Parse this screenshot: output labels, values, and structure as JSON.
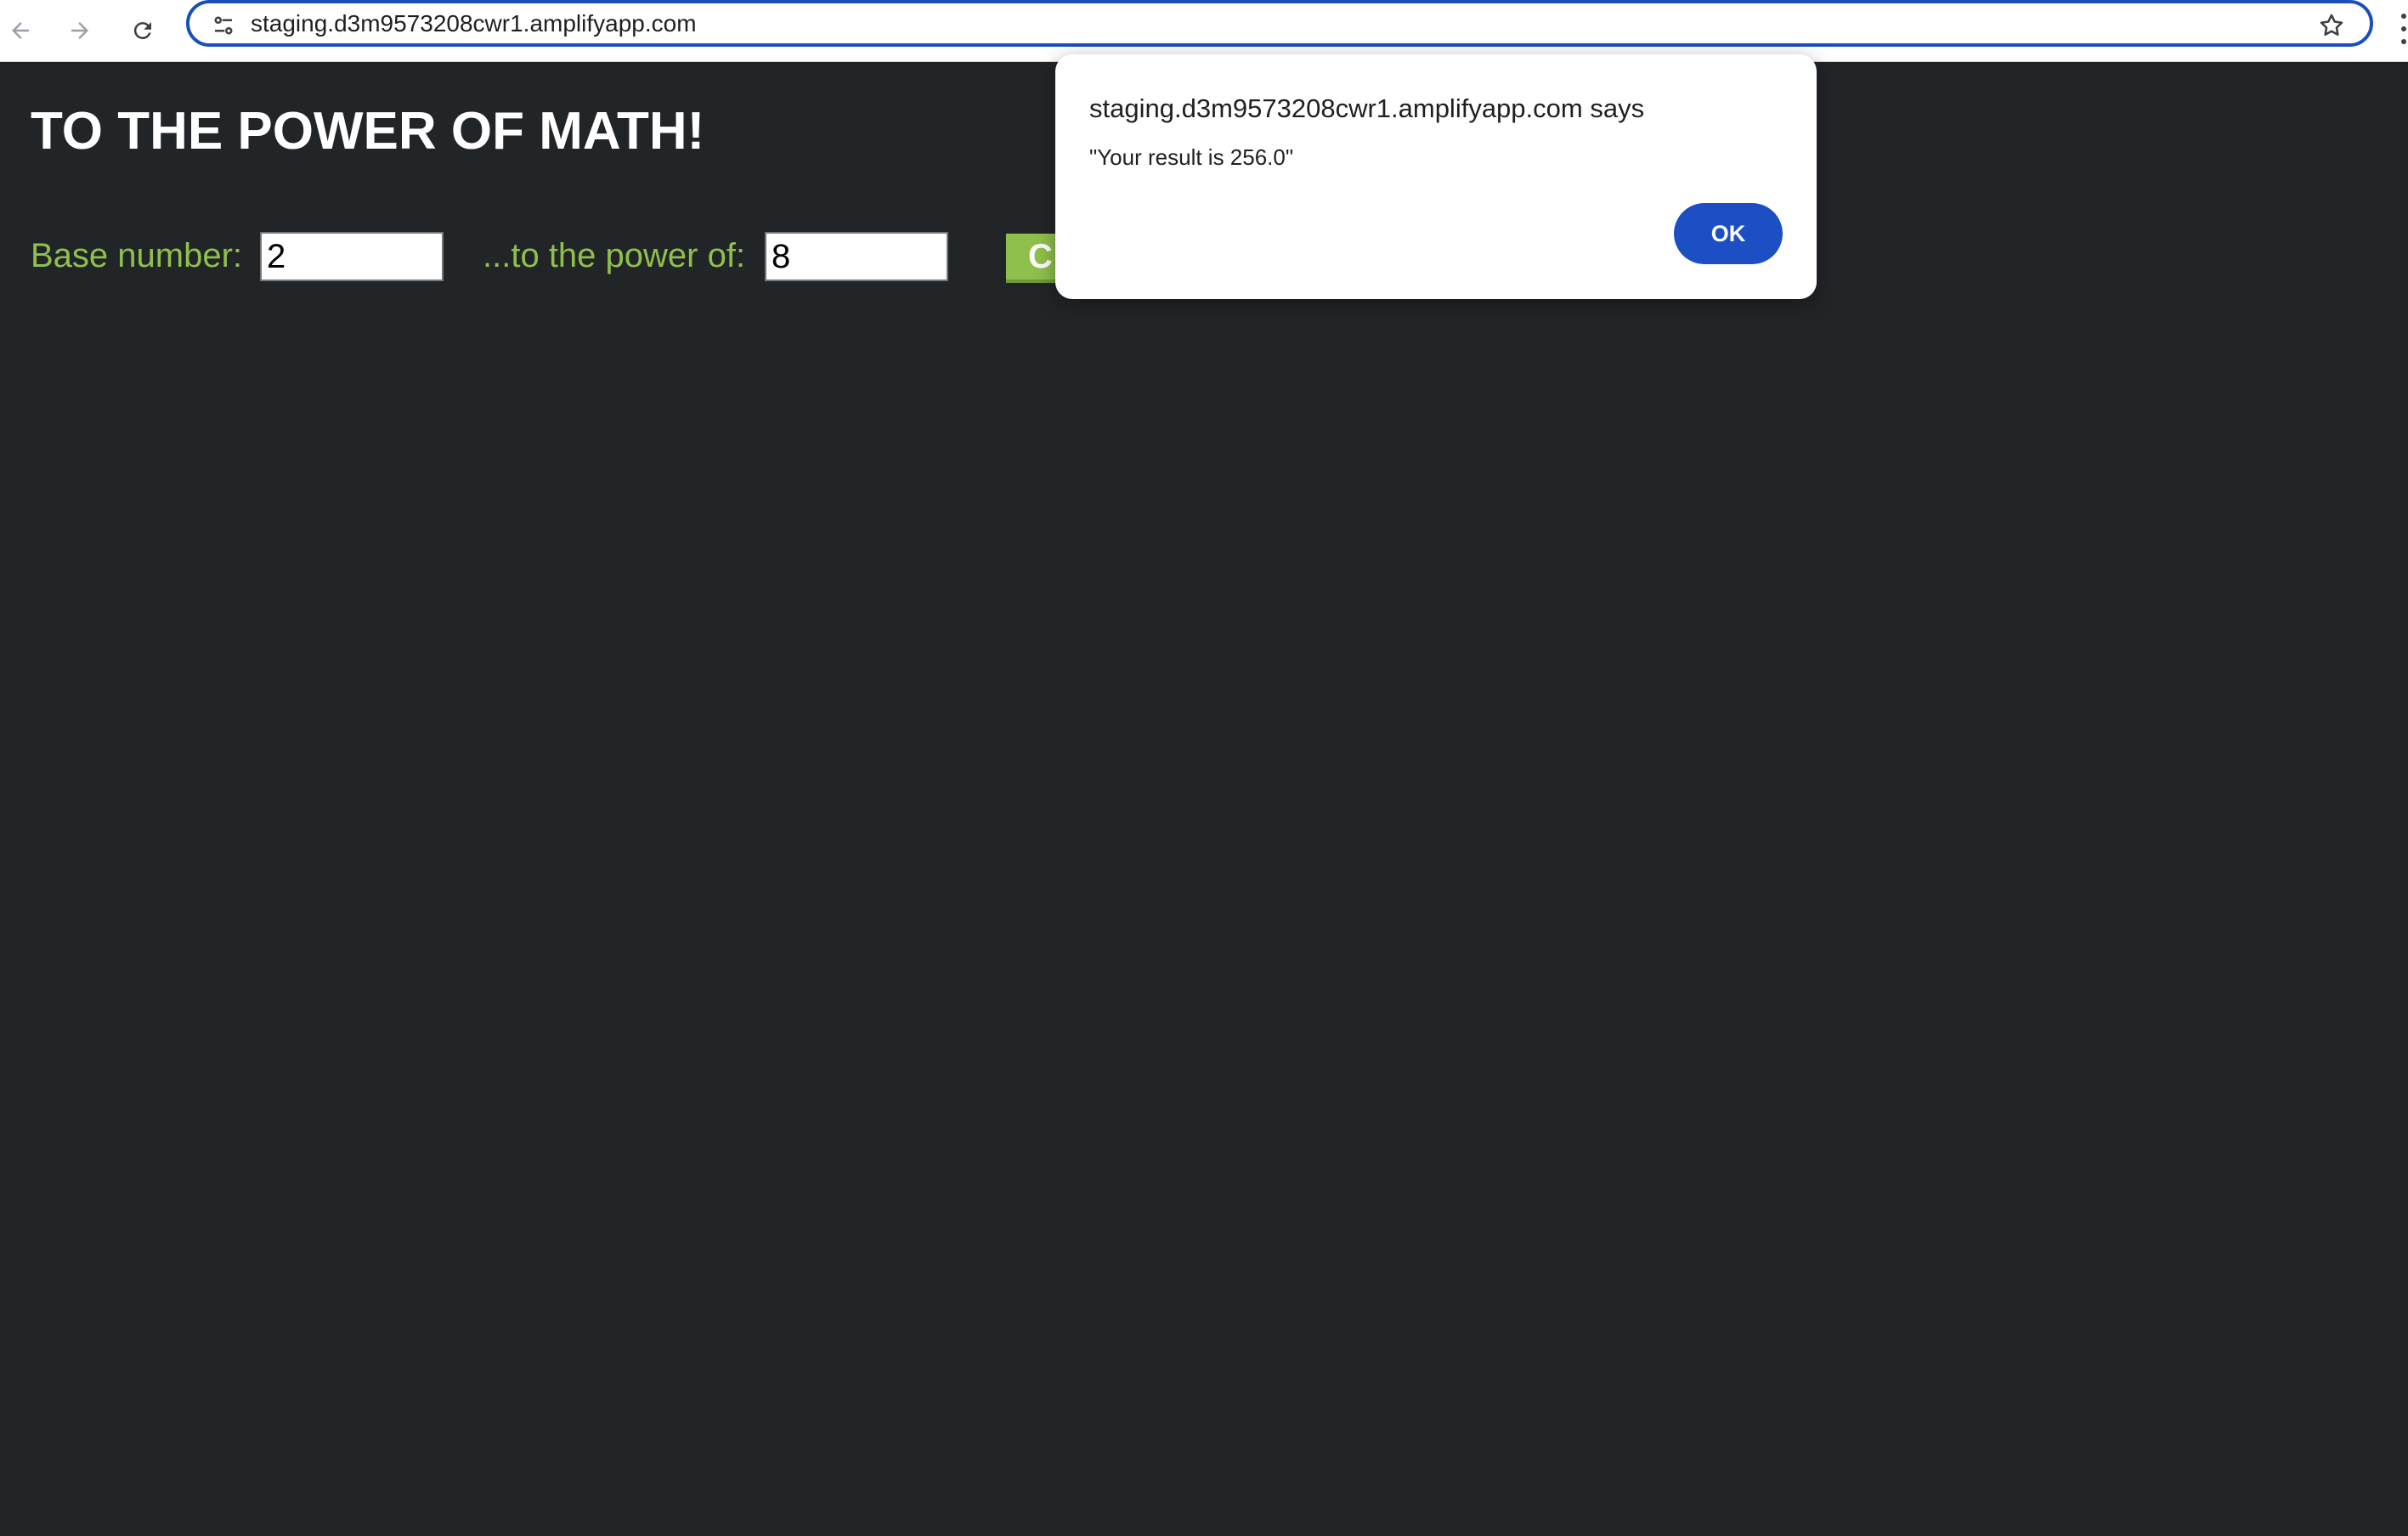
{
  "browser": {
    "url": "staging.d3m9573208cwr1.amplifyapp.com",
    "accent_color": "#1a4fba"
  },
  "page": {
    "title": "TO THE POWER OF MATH!",
    "base_label": "Base number:",
    "base_value": "2",
    "power_label": "...to the power of:",
    "power_value": "8",
    "calculate_label": "C",
    "label_color": "#8fc04c",
    "background_color": "#222528"
  },
  "alert": {
    "title": "staging.d3m9573208cwr1.amplifyapp.com says",
    "message": "\"Your result is 256.0\"",
    "ok_label": "OK",
    "button_color": "#1d4fc4"
  },
  "icons": {
    "back": "arrow-left-icon",
    "forward": "arrow-right-icon",
    "reload": "reload-icon",
    "site_info": "tune-icon",
    "bookmark": "star-icon",
    "menu": "more-vert-icon"
  }
}
